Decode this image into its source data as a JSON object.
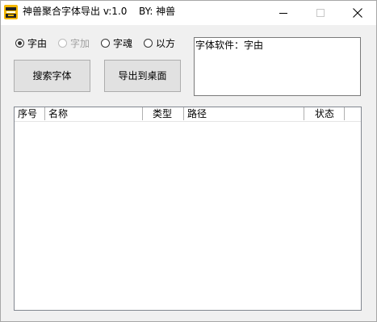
{
  "window": {
    "title": "神兽聚合字体导出 v:1.0",
    "author": "BY: 神兽"
  },
  "font_options": [
    {
      "label": "字由",
      "checked": true,
      "disabled": false
    },
    {
      "label": "字加",
      "checked": false,
      "disabled": true
    },
    {
      "label": "字魂",
      "checked": false,
      "disabled": false
    },
    {
      "label": "以方",
      "checked": false,
      "disabled": false
    }
  ],
  "buttons": {
    "search": "搜索字体",
    "export": "导出到桌面"
  },
  "info_text": "字体软件：字由",
  "table": {
    "columns": [
      "序号",
      "名称",
      "类型",
      "路径",
      "状态"
    ],
    "rows": []
  },
  "colors": {
    "icon_bg": "#f5b800",
    "icon_dark": "#222222"
  }
}
